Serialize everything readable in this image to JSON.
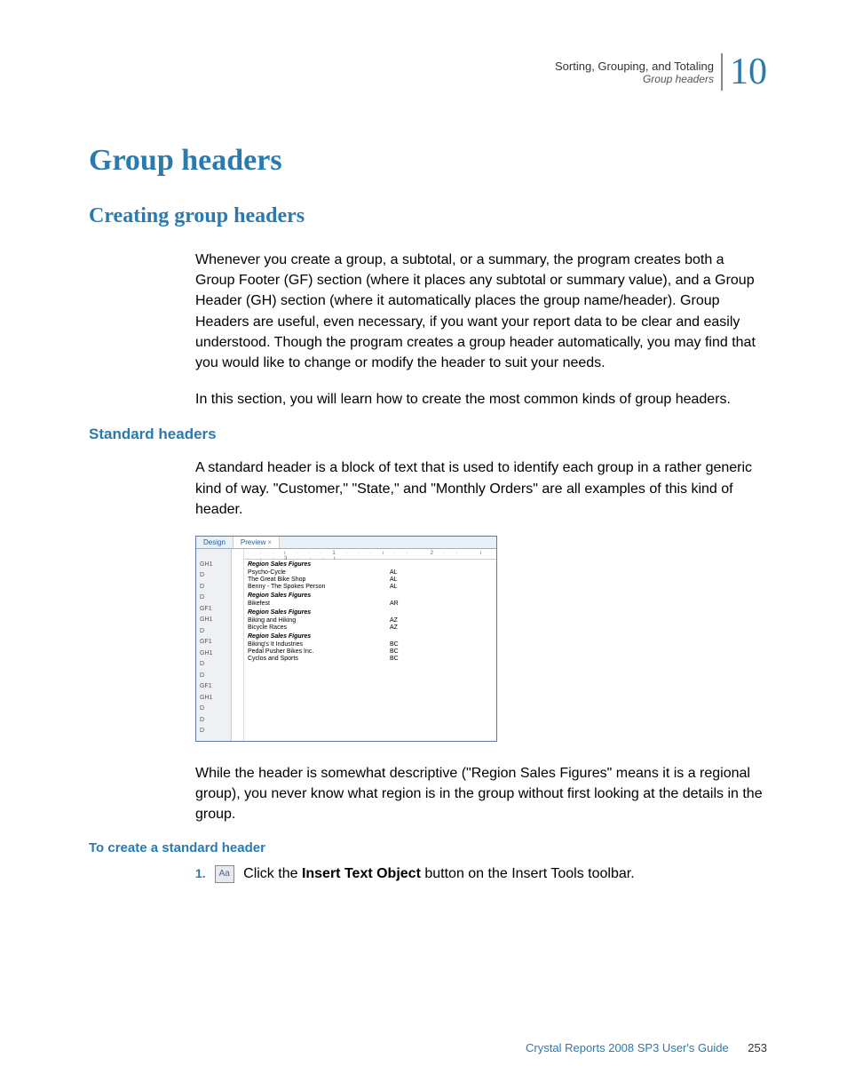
{
  "header": {
    "breadcrumb": "Sorting, Grouping, and Totaling",
    "section": "Group headers",
    "chapter": "10"
  },
  "h1": "Group headers",
  "h2": "Creating group headers",
  "p1": "Whenever you create a group, a subtotal, or a summary, the program creates both a Group Footer (GF) section (where it places any subtotal or summary value), and a Group Header (GH) section (where it automatically places the group name/header). Group Headers are useful, even necessary, if you want your report data to be clear and easily understood. Though the program creates a group header automatically, you may find that you would like to change or modify the header to suit your needs.",
  "p2": "In this section, you will learn how to create the most common kinds of group headers.",
  "h3": "Standard headers",
  "p3": "A standard header is a block of text that is used to identify each group in a rather generic kind of way. \"Customer,\" \"State,\" and \"Monthly Orders\" are all examples of this kind of header.",
  "screenshot": {
    "tabs": {
      "design": "Design",
      "preview": "Preview",
      "close": "×"
    },
    "ruler": "· · · ı · · · 1 · · · ı · · · 2 · · · ı · · · 3 · · · ı",
    "gutter": [
      "GH1",
      "D",
      "D",
      "D",
      "GF1",
      "GH1",
      "D",
      "GF1",
      "GH1",
      "D",
      "D",
      "GF1",
      "GH1",
      "D",
      "D",
      "D"
    ],
    "groups": [
      {
        "title": "Region Sales Figures",
        "rows": [
          {
            "name": "Psycho-Cycle",
            "region": "AL"
          },
          {
            "name": "The Great Bike Shop",
            "region": "AL"
          },
          {
            "name": "Benny - The Spokes Person",
            "region": "AL"
          }
        ]
      },
      {
        "title": "Region Sales Figures",
        "rows": [
          {
            "name": "Bikefest",
            "region": "AR"
          }
        ]
      },
      {
        "title": "Region Sales Figures",
        "rows": [
          {
            "name": "Biking and Hiking",
            "region": "AZ"
          },
          {
            "name": "Bicycle Races",
            "region": "AZ"
          }
        ]
      },
      {
        "title": "Region Sales Figures",
        "rows": [
          {
            "name": "Biking's It Industries",
            "region": "BC"
          },
          {
            "name": "Pedal Pusher Bikes Inc.",
            "region": "BC"
          },
          {
            "name": "Cyclos and Sports",
            "region": "BC"
          }
        ]
      }
    ]
  },
  "p4": "While the header is somewhat descriptive (\"Region Sales Figures\" means it is a regional group), you never know what region is in the group without first looking at the details in the group.",
  "h4": "To create a standard header",
  "step1": {
    "num": "1.",
    "icon": "Aa",
    "pre": " Click the ",
    "bold": "Insert Text Object",
    "post": " button on the Insert Tools toolbar."
  },
  "footer": {
    "book": "Crystal Reports 2008 SP3 User's Guide",
    "page": "253"
  }
}
